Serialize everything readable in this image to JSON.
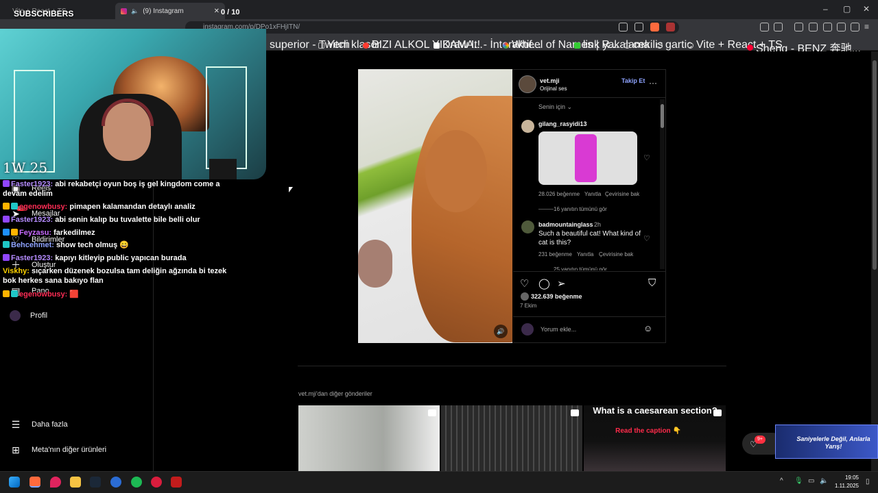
{
  "browser": {
    "tabs": [
      {
        "label": "Vite + React + TS",
        "active": false
      },
      {
        "label": "(9) Instagram",
        "active": true
      }
    ],
    "url": "instagram.com/p/DPo1xFHjITN/",
    "bookmarks": [
      {
        "label": "superior - Twitch",
        "color": "#9146ff"
      },
      {
        "label": "Yeni klasör",
        "color": "#bbbbbb"
      },
      {
        "label": "BIZI ALKOL YIKAMA...",
        "color": "#ff3b30"
      },
      {
        "label": "Draw It! - İnteraktif...",
        "color": "#ffffff"
      },
      {
        "label": "Wheel of Names | R...",
        "color": "#f4b400"
      },
      {
        "label": "link yakalama",
        "color": "#33cc33"
      },
      {
        "label": "cekilis",
        "color": "#cccccc"
      },
      {
        "label": "gartic",
        "color": "#cccccc"
      },
      {
        "label": "Vite + React + TS",
        "color": "#cccccc"
      },
      {
        "label": "Sheng - BENZ 奔驰...",
        "color": "#ff0033"
      }
    ]
  },
  "overlay": {
    "subscribers_label": "SUBSCRIBERS",
    "sub_counter": "0 / 10",
    "timer": "1W 25",
    "chat": [
      {
        "user": "Faster1923:",
        "msg": "abi rekabetçi oyun boş iş gel kingdom come a devam edelim",
        "color": "#b58cff"
      },
      {
        "user": "egenowbusy:",
        "msg": "pimapen kalamandan detaylı analiz",
        "color": "#ff2d55"
      },
      {
        "user": "Faster1923:",
        "msg": "abi senin kalıp bu tuvalette bile belli olur",
        "color": "#b58cff"
      },
      {
        "user": "Feyzasu:",
        "msg": "farkedilmez",
        "color": "#c86bff"
      },
      {
        "user": "Behcehmet:",
        "msg": "show tech olmuş 😄",
        "color": "#8ea3ff"
      },
      {
        "user": "Faster1923:",
        "msg": "kapıyı kitleyip public yapıcan burada",
        "color": "#b58cff"
      },
      {
        "user": "Viskhy:",
        "msg": "sıçarken düzenek bozulsa tam deliğin ağzında bi tezek bok herkes sana bakıyo flan",
        "color": "#ffd400"
      },
      {
        "user": "egenowbusy:",
        "msg": "🟥",
        "color": "#ff2d55"
      }
    ]
  },
  "sidebar": {
    "items": [
      {
        "label": "Reels",
        "icon": "reels-icon"
      },
      {
        "label": "Mesajlar",
        "icon": "messages-icon"
      },
      {
        "label": "Bildirimler",
        "icon": "heart-icon"
      },
      {
        "label": "Oluştur",
        "icon": "plus-icon"
      },
      {
        "label": "Pano",
        "icon": "dashboard-icon"
      },
      {
        "label": "Profil",
        "icon": "avatar"
      }
    ],
    "more_label": "Daha fazla",
    "meta_label": "Meta'nın diğer ürünleri",
    "messages_badge": "9+"
  },
  "post": {
    "username": "vet.mji",
    "audio": "Orijinal ses",
    "follow_label": "Takip Et",
    "for_you": "Senin için",
    "comments": [
      {
        "user": "gilang_rasyidi13",
        "text": "",
        "likes": "28.026 beğenme",
        "reply": "Yanıtla",
        "translate": "Çevirisine bak",
        "view_replies": "16 yanıtın tümünü gör"
      },
      {
        "user": "badmountainglass",
        "time": "2h",
        "text": "Such a beautiful cat! What kind of cat is this?",
        "likes": "231 beğenme",
        "reply": "Yanıtla",
        "translate": "Çevirisine bak",
        "view_replies": "25 yanıtın tümünü gör"
      }
    ],
    "likes": "322.639 beğenme",
    "date": "7 Ekim",
    "comment_placeholder": "Yorum ekle..."
  },
  "more_posts": {
    "title": "vet.mji'dan diğer gönderiler",
    "thumb3_title": "What is a caesarean section?",
    "thumb3_caption": "Read the caption 👇"
  },
  "notifications": {
    "badge": "9+"
  },
  "ad": {
    "text": "Saniyelerle Değil, Anlarla Yarış!"
  },
  "taskbar": {
    "time": "19:05",
    "date": "1.11.2025"
  }
}
